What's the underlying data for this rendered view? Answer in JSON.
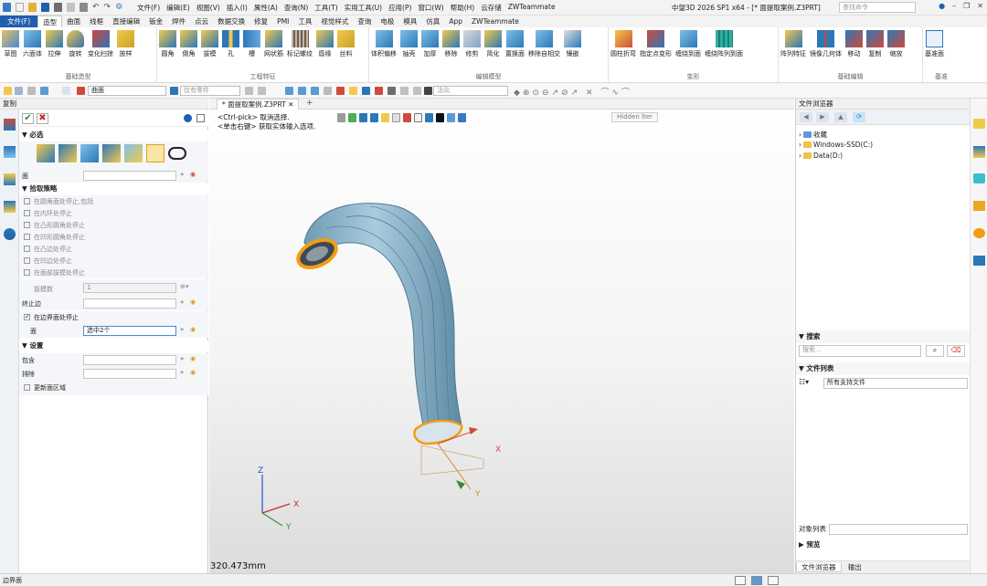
{
  "titlebar": {
    "menus": [
      "文件(F)",
      "编辑(E)",
      "视图(V)",
      "插入(I)",
      "属性(A)",
      "查询(N)",
      "工具(T)",
      "实用工具(U)",
      "应用(P)",
      "窗口(W)",
      "帮助(H)",
      "云存储",
      "ZWTeammate"
    ],
    "window_title": "中望3D 2026 SP1 x64 - [* 面提取案例.Z3PRT]",
    "search_placeholder": "查找命令"
  },
  "ribbon_tabs": [
    "文件(F)",
    "造型",
    "曲面",
    "线框",
    "直接编辑",
    "钣金",
    "焊件",
    "点云",
    "数据交换",
    "修复",
    "PMI",
    "工具",
    "视觉样式",
    "查询",
    "电极",
    "模具",
    "仿真",
    "App",
    "ZWTeammate"
  ],
  "ribbon": {
    "basic": {
      "label": "基础造型",
      "buttons": [
        "草图",
        "六面体",
        "拉伸",
        "旋转",
        "变化扫掠",
        "放样"
      ]
    },
    "eng": {
      "label": "工程特征",
      "buttons": [
        "圆角",
        "倒角",
        "拔模",
        "孔",
        "槽",
        "网状筋",
        "标记螺纹",
        "唇缘",
        "丝料"
      ]
    },
    "edit": {
      "label": "编辑模型",
      "buttons": [
        "体积偏移",
        "抽壳",
        "加厚",
        "移除",
        "修剪",
        "简化",
        "置换面",
        "移除自相交",
        "镶嵌"
      ]
    },
    "deform": {
      "label": "变形",
      "buttons": [
        "圆柱折弯",
        "指定点变形",
        "缠绕到面",
        "缠绕阵列到面"
      ]
    },
    "basicedit": {
      "label": "基础编辑",
      "buttons": [
        "阵列特征",
        "镜像几何体",
        "移动",
        "复制",
        "缩放"
      ]
    },
    "datum": {
      "label": "基准",
      "buttons": [
        "基准面"
      ]
    }
  },
  "toolbar2": {
    "filter": "曲面",
    "scope_placeholder": "仅有零件",
    "direction_placeholder": "法向"
  },
  "panel": {
    "title": "复制",
    "required": {
      "header": "必选",
      "face_label": "面"
    },
    "strategy": {
      "header": "拾取策略",
      "options": [
        "在圆角面处停止,包括",
        "在内环处停止",
        "在凸形圆角处停止",
        "在凹形圆角处停止",
        "在凸边处停止",
        "在凹边处停止",
        "在面部拔模处停止"
      ],
      "draft_label": "拔模数",
      "draft_value": "1",
      "stop_edge_label": "终止边",
      "boundary_stop_label": "在边界面处停止",
      "boundary_face_label": "面",
      "boundary_face_value": "选中2个"
    },
    "settings": {
      "header": "设置",
      "include_label": "包含",
      "exclude_label": "排除",
      "update_label": "更新面区域"
    }
  },
  "viewport": {
    "tab": "* 面提取案例.Z3PRT",
    "hint1": "<Ctrl-pick> 取消选择.",
    "hint2": "<单击右键> 获取实体输入选项.",
    "render_mode": "Hidden lter",
    "scale": "320.473mm",
    "axes": {
      "x": "X",
      "y": "Y",
      "z": "Z"
    }
  },
  "right": {
    "title": "文件浏览器",
    "tree": [
      "收藏",
      "Windows-SSD(C:)",
      "Data(D:)"
    ],
    "search_header": "搜索",
    "search_placeholder": "搜索...",
    "filelist_header": "文件列表",
    "filetype": "所有支持文件",
    "objlist_label": "对象列表",
    "preview_header": "预览",
    "bottom_tabs": [
      "文件浏览器",
      "输出"
    ]
  },
  "status": {
    "text": "边界面"
  },
  "colors": {
    "accent": "#1f5fad",
    "selection": "#f39c12",
    "model": "#8fb5c9"
  }
}
